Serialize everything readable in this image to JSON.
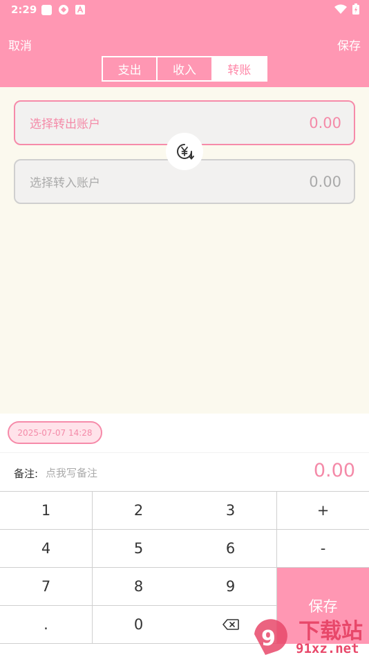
{
  "status_bar": {
    "time": "2:29"
  },
  "header": {
    "cancel_label": "取消",
    "save_label": "保存",
    "tabs": [
      {
        "label": "支出",
        "active": false
      },
      {
        "label": "收入",
        "active": false
      },
      {
        "label": "转账",
        "active": true
      }
    ]
  },
  "transfer": {
    "from": {
      "placeholder": "选择转出账户",
      "amount": "0.00"
    },
    "to": {
      "placeholder": "选择转入账户",
      "amount": "0.00"
    },
    "swap_icon": "yuan-swap-icon"
  },
  "footer": {
    "datetime": "2025-07-07 14:28",
    "note_label": "备注:",
    "note_placeholder": "点我写备注",
    "note_value": "",
    "total": "0.00"
  },
  "keypad": {
    "keys": [
      "1",
      "2",
      "3",
      "+",
      "4",
      "5",
      "6",
      "-",
      "7",
      "8",
      "9",
      ".",
      "0"
    ],
    "backspace_icon": "backspace-icon",
    "save_label": "保存"
  },
  "watermark": {
    "text": "下载站",
    "sub": "91xz.net"
  },
  "colors": {
    "accent": "#ff97b3",
    "accent_text": "#f48aa8",
    "background": "#fbf9ee"
  }
}
